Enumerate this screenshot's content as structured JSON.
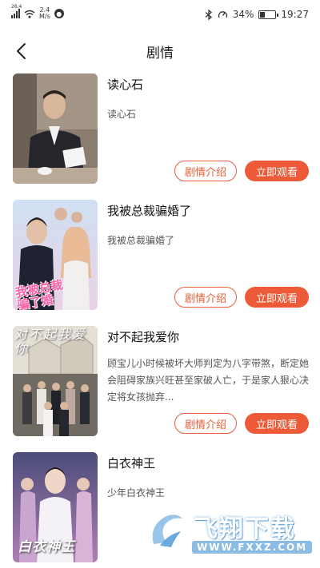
{
  "status_bar": {
    "network": "26.4",
    "speed_value": "2.4",
    "speed_unit": "M/s",
    "battery_percent": "34%",
    "battery_level": 0.34,
    "time": "19:27"
  },
  "header": {
    "title": "剧情"
  },
  "dramas": [
    {
      "title": "读心石",
      "description": "读心石",
      "intro_label": "剧情介绍",
      "watch_label": "立即观看"
    },
    {
      "title": "我被总裁骗婚了",
      "description": "我被总裁骗婚了",
      "poster_text": "我被总裁\n骗了婚",
      "intro_label": "剧情介绍",
      "watch_label": "立即观看"
    },
    {
      "title": "对不起我爱你",
      "description": "顾宝儿小时候被坏大师判定为八字带煞，断定她会阻碍家族兴旺甚至家破人亡，于是家人狠心决定将女孩抛弃...",
      "poster_text": "对不起我爱你",
      "intro_label": "剧情介绍",
      "watch_label": "立即观看"
    },
    {
      "title": "白衣神王",
      "description": "少年白衣神王",
      "poster_text": "白衣神王"
    }
  ],
  "watermark": {
    "brand": "飞翔下载",
    "url": "WWW.FXXZ.COM"
  },
  "colors": {
    "accent": "#ec5a38",
    "accent_outline": "#e8603c"
  }
}
